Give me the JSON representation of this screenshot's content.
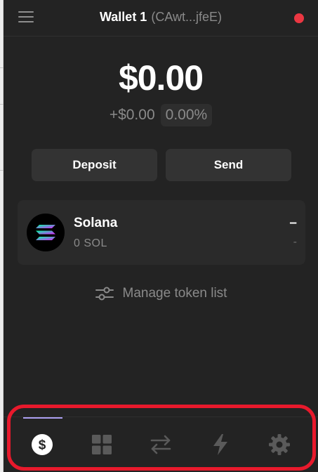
{
  "header": {
    "wallet_name": "Wallet 1",
    "wallet_address": "(CAwt...jfeE)",
    "menu_icon": "hamburger-menu-icon",
    "status_color": "#eb3742"
  },
  "balance": {
    "total": "$0.00",
    "change_value": "+$0.00",
    "change_percent": "0.00%"
  },
  "actions": {
    "deposit_label": "Deposit",
    "send_label": "Send"
  },
  "tokens": [
    {
      "name": "Solana",
      "amount": "0 SOL",
      "value": "–",
      "change": "-",
      "icon": "solana-logo-icon"
    }
  ],
  "manage": {
    "label": "Manage token list",
    "icon": "sliders-icon"
  },
  "bottom_nav": {
    "items": [
      {
        "name": "tokens",
        "icon": "dollar-circle-icon",
        "active": true
      },
      {
        "name": "collectibles",
        "icon": "grid-icon",
        "active": false
      },
      {
        "name": "swap",
        "icon": "swap-arrows-icon",
        "active": false
      },
      {
        "name": "activity",
        "icon": "lightning-icon",
        "active": false
      },
      {
        "name": "settings",
        "icon": "gear-icon",
        "active": false
      }
    ],
    "indicator_color": "#ab9ff2",
    "highlight_color": "#e8192c"
  }
}
